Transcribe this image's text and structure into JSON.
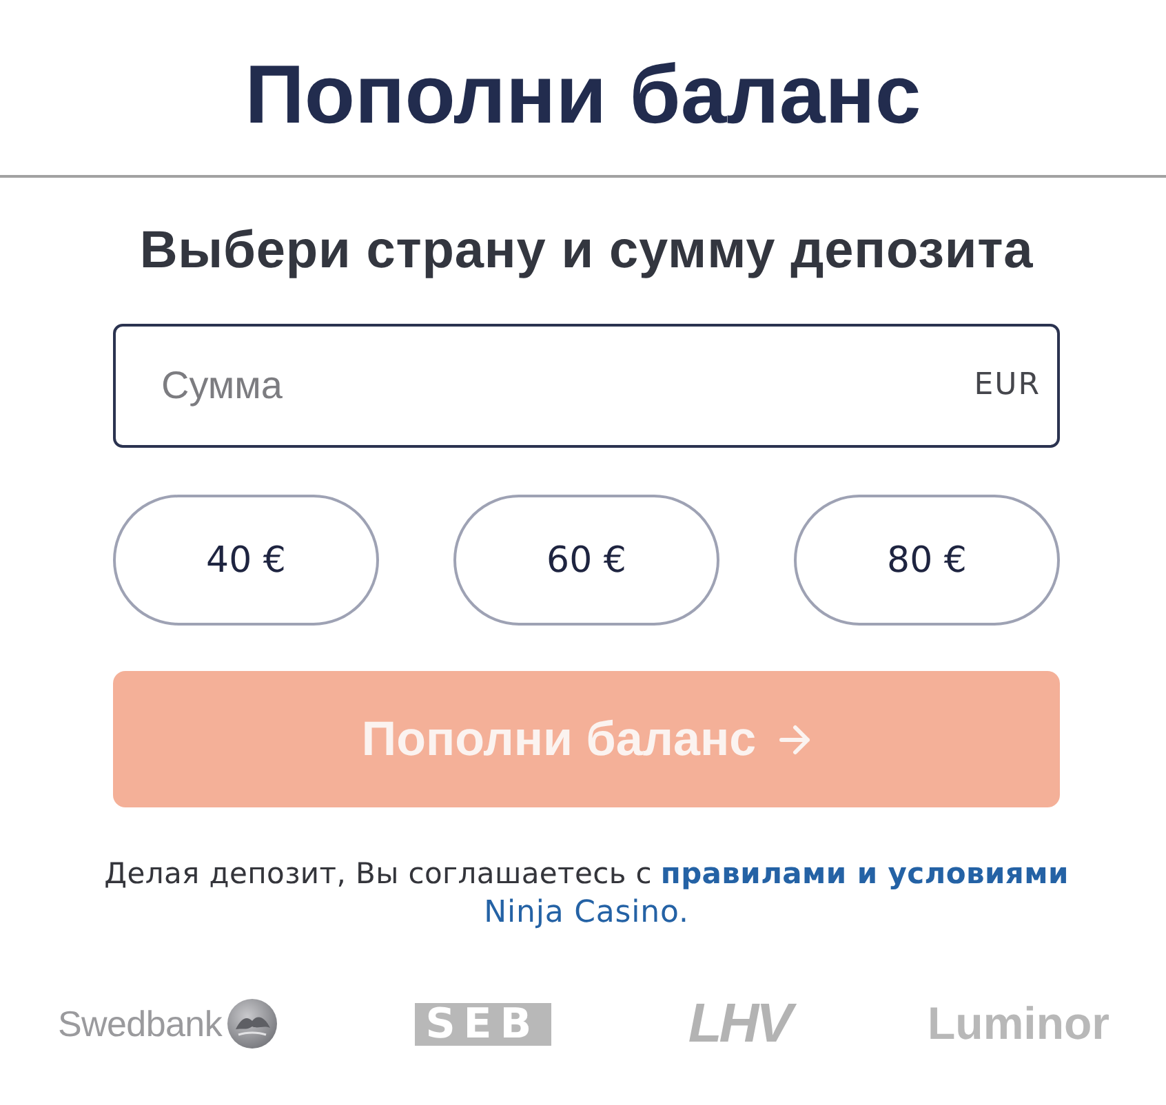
{
  "header": {
    "title": "Пополни баланс"
  },
  "form": {
    "subtitle": "Выбери страну и сумму депозита",
    "amount_field": {
      "placeholder": "Сумма",
      "currency": "EUR"
    },
    "preset_amounts": [
      {
        "label": "40 €",
        "selected": false
      },
      {
        "label": "60 €",
        "selected": false
      },
      {
        "label": "80 €",
        "selected": false
      }
    ],
    "submit_button": {
      "label": "Пополни баланс",
      "disabled": true
    }
  },
  "terms": {
    "text": "Делая депозит, Вы соглашаетесь с",
    "links": [
      {
        "kind": "terms",
        "text": "правилами и условиями"
      },
      {
        "kind": "brand",
        "text": "Ninja Casino."
      }
    ]
  },
  "bank_logos": [
    {
      "kind": "emblem",
      "text": "Swedbank"
    },
    {
      "kind": "boxed",
      "text": "SEB"
    },
    {
      "kind": "italic",
      "text": "LHV"
    },
    {
      "kind": "plain",
      "text": "Luminor"
    }
  ]
}
